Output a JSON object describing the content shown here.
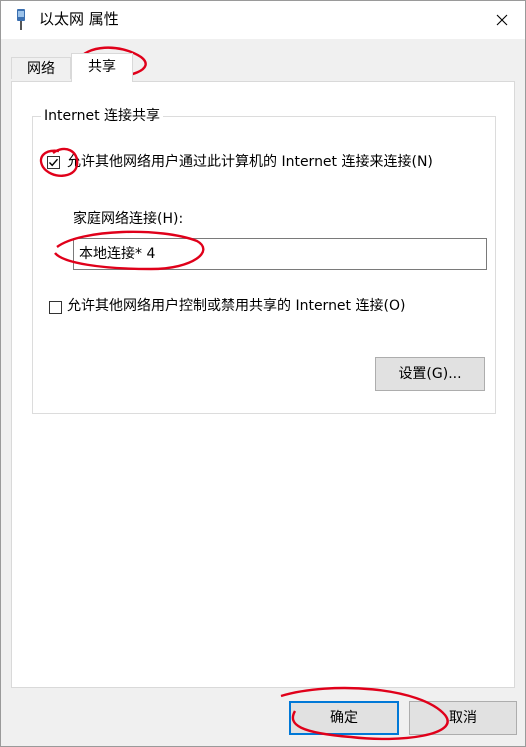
{
  "window": {
    "title": "以太网 属性",
    "icon": "network-adapter-icon"
  },
  "tabs": [
    {
      "label": "网络",
      "active": false
    },
    {
      "label": "共享",
      "active": true
    }
  ],
  "sharing": {
    "group_title": "Internet 连接共享",
    "allow_connect": {
      "label": "允许其他网络用户通过此计算机的 Internet 连接来连接(N)",
      "checked": true
    },
    "home_network_label": "家庭网络连接(H):",
    "home_network_value": "本地连接* 4",
    "allow_control": {
      "label": "允许其他网络用户控制或禁用共享的 Internet 连接(O)",
      "checked": false
    },
    "settings_button": "设置(G)..."
  },
  "footer": {
    "ok_label": "确定",
    "cancel_label": "取消"
  },
  "annotation_color": "#e0001a"
}
